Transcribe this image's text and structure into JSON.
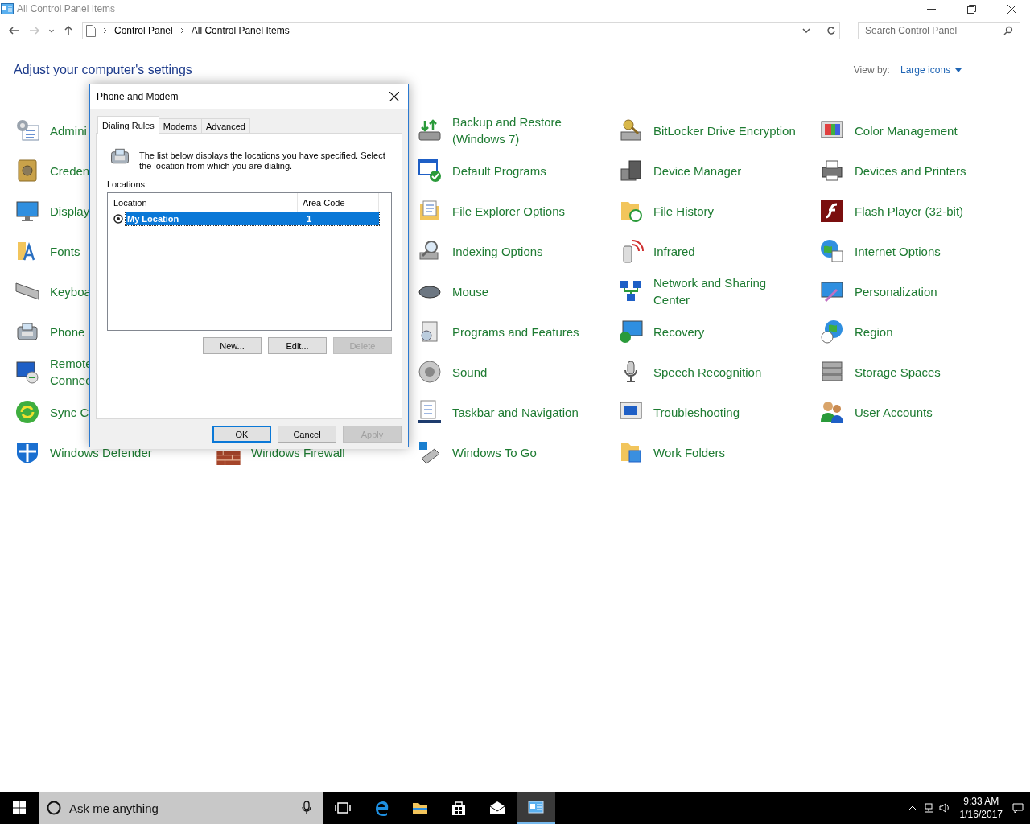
{
  "window": {
    "title": "All Control Panel Items"
  },
  "nav": [
    {
      "kind": "back",
      "disabled": false
    },
    {
      "kind": "forward",
      "disabled": true
    },
    {
      "kind": "recent",
      "disabled": false
    },
    {
      "kind": "up",
      "disabled": false
    }
  ],
  "address": {
    "crumbs": [
      "Control Panel",
      "All Control Panel Items"
    ]
  },
  "search": {
    "placeholder": "Search Control Panel"
  },
  "header": {
    "title": "Adjust your computer's settings",
    "view_by_label": "View by:",
    "view_by_value": "Large icons"
  },
  "columns": [
    [
      {
        "label": "Admini"
      },
      {
        "label": "Creden"
      },
      {
        "label": "Display"
      },
      {
        "label": "Fonts"
      },
      {
        "label": "Keyboa"
      },
      {
        "label": "Phone"
      },
      {
        "label": "Remote\nConnec"
      },
      {
        "label": "Sync C"
      },
      {
        "label": "Windows Defender"
      }
    ],
    [
      {
        "label": "Windows Firewall"
      }
    ],
    [
      {
        "label": "Backup and Restore\n(Windows 7)"
      },
      {
        "label": "Default Programs"
      },
      {
        "label": "File Explorer Options"
      },
      {
        "label": "Indexing Options"
      },
      {
        "label": "Mouse"
      },
      {
        "label": "Programs and Features"
      },
      {
        "label": "Sound"
      },
      {
        "label": "Taskbar and Navigation"
      },
      {
        "label": "Windows To Go"
      }
    ],
    [
      {
        "label": "BitLocker Drive Encryption"
      },
      {
        "label": "Device Manager"
      },
      {
        "label": "File History"
      },
      {
        "label": "Infrared"
      },
      {
        "label": "Network and Sharing\nCenter"
      },
      {
        "label": "Recovery"
      },
      {
        "label": "Speech Recognition"
      },
      {
        "label": "Troubleshooting"
      },
      {
        "label": "Work Folders"
      }
    ],
    [
      {
        "label": "Color Management"
      },
      {
        "label": "Devices and Printers"
      },
      {
        "label": "Flash Player (32-bit)"
      },
      {
        "label": "Internet Options"
      },
      {
        "label": "Personalization"
      },
      {
        "label": "Region"
      },
      {
        "label": "Storage Spaces"
      },
      {
        "label": "User Accounts"
      }
    ]
  ],
  "dialog": {
    "title": "Phone and Modem",
    "tabs": [
      {
        "label": "Dialing Rules",
        "selected": true
      },
      {
        "label": "Modems",
        "selected": false
      },
      {
        "label": "Advanced",
        "selected": false
      }
    ],
    "description": "The list below displays the locations you have specified. Select the location from which you are dialing.",
    "list_label": "Locations:",
    "list_columns": [
      "Location",
      "Area Code"
    ],
    "rows": [
      {
        "location": "My Location",
        "area_code": "1",
        "selected": true
      }
    ],
    "list_buttons": [
      {
        "label": "New...",
        "disabled": false
      },
      {
        "label": "Edit...",
        "disabled": false
      },
      {
        "label": "Delete",
        "disabled": true
      }
    ],
    "footer_buttons": [
      {
        "label": "OK",
        "disabled": false,
        "default": true
      },
      {
        "label": "Cancel",
        "disabled": false,
        "default": false
      },
      {
        "label": "Apply",
        "disabled": true,
        "default": false
      }
    ]
  },
  "taskbar": {
    "search_placeholder": "Ask me anything",
    "apps": [
      {
        "kind": "taskview",
        "selected": false
      },
      {
        "kind": "edge",
        "selected": false
      },
      {
        "kind": "explorer",
        "selected": false
      },
      {
        "kind": "store",
        "selected": false
      },
      {
        "kind": "mail",
        "selected": false
      },
      {
        "kind": "controlpanel",
        "selected": true
      }
    ],
    "time": "9:33 AM",
    "date": "1/16/2017"
  }
}
